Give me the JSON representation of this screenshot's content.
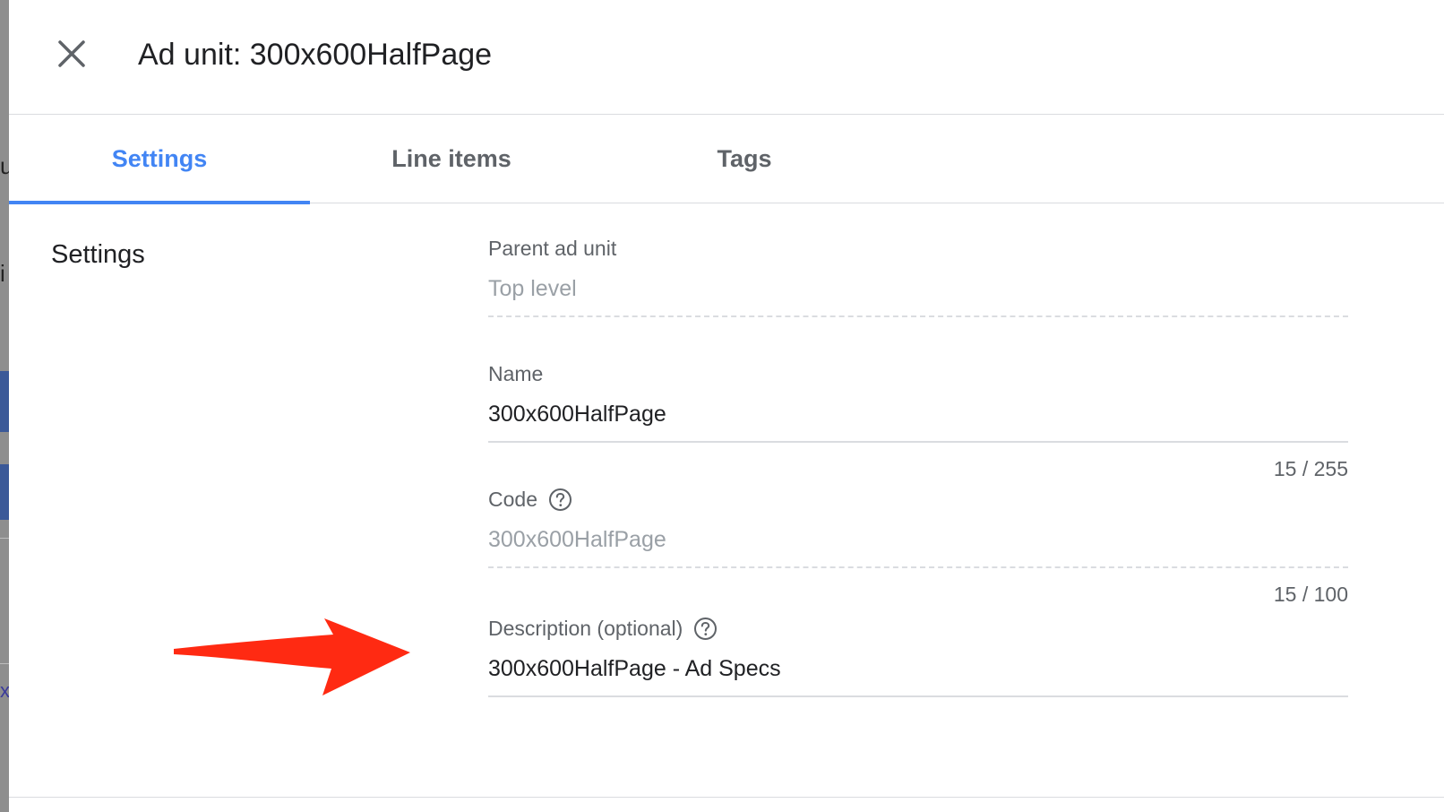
{
  "header": {
    "title": "Ad unit: 300x600HalfPage",
    "close_icon": "close-icon"
  },
  "tabs": [
    {
      "label": "Settings",
      "active": true
    },
    {
      "label": "Line items",
      "active": false
    },
    {
      "label": "Tags",
      "active": false
    }
  ],
  "section": {
    "title": "Settings"
  },
  "fields": {
    "parent": {
      "label": "Parent ad unit",
      "value": "Top level"
    },
    "name": {
      "label": "Name",
      "value": "300x600HalfPage",
      "counter": "15 / 255"
    },
    "code": {
      "label": "Code",
      "value": "300x600HalfPage",
      "counter": "15 / 100",
      "help_icon": "help-circle-icon"
    },
    "description": {
      "label": "Description (optional)",
      "value": "300x600HalfPage - Ad Specs",
      "help_icon": "help-circle-icon"
    }
  },
  "colors": {
    "accent": "#4285f4",
    "annotation_arrow": "#ff2a12",
    "text_primary": "#202124",
    "text_secondary": "#5f6368",
    "divider": "#dadce0"
  }
}
